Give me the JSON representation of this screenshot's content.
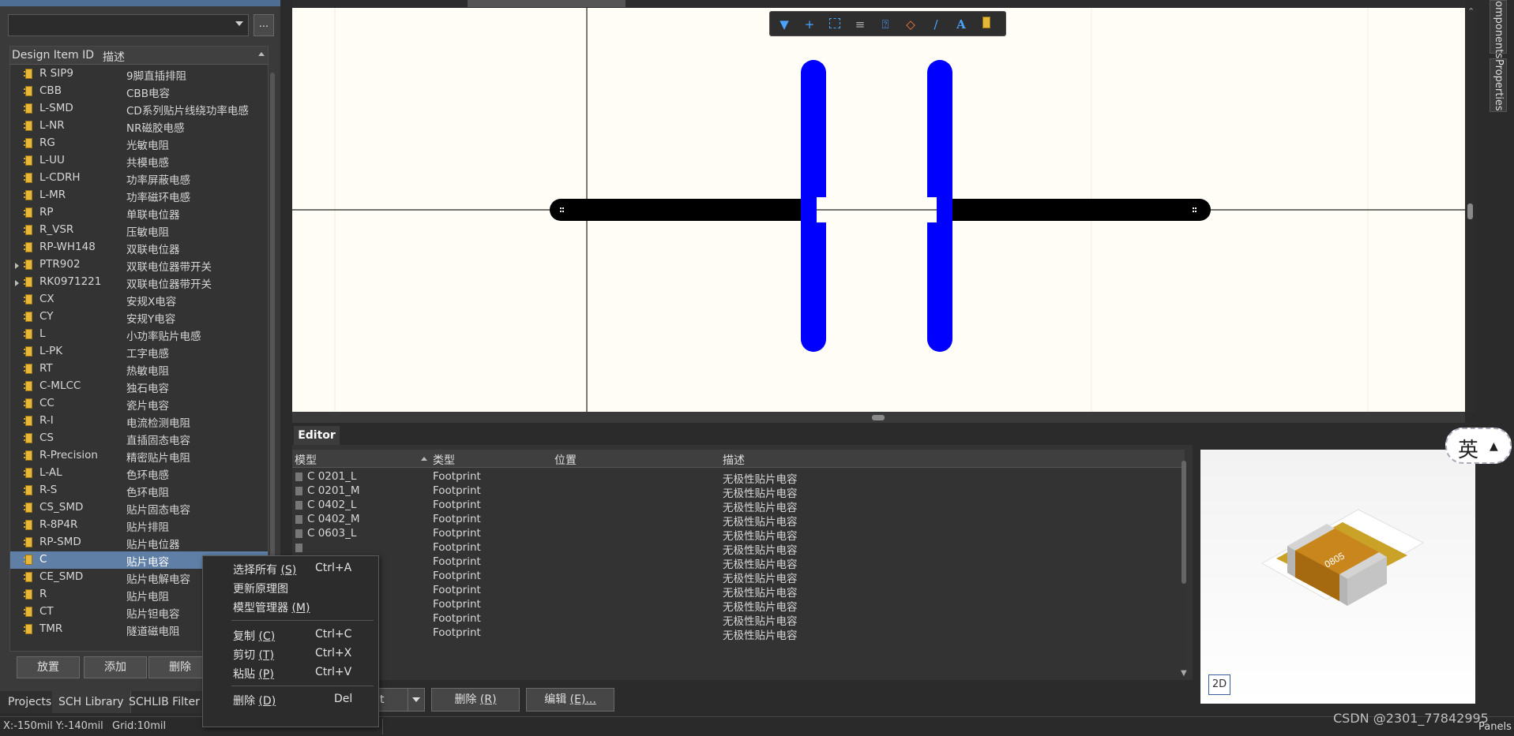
{
  "library": {
    "search_value": "",
    "more_label": "...",
    "columns": [
      "Design Item ID",
      "描述"
    ],
    "rows": [
      {
        "id": "R SIP9",
        "desc": "9脚直插排阻",
        "expandable": false
      },
      {
        "id": "CBB",
        "desc": "CBB电容",
        "expandable": false
      },
      {
        "id": "L-SMD",
        "desc": "CD系列贴片线绕功率电感",
        "expandable": false
      },
      {
        "id": "L-NR",
        "desc": "NR磁胶电感",
        "expandable": false
      },
      {
        "id": "RG",
        "desc": "光敏电阻",
        "expandable": false
      },
      {
        "id": "L-UU",
        "desc": "共模电感",
        "expandable": false
      },
      {
        "id": "L-CDRH",
        "desc": "功率屏蔽电感",
        "expandable": false
      },
      {
        "id": "L-MR",
        "desc": "功率磁环电感",
        "expandable": false
      },
      {
        "id": "RP",
        "desc": "单联电位器",
        "expandable": false
      },
      {
        "id": "R_VSR",
        "desc": "压敏电阻",
        "expandable": false
      },
      {
        "id": "RP-WH148",
        "desc": "双联电位器",
        "expandable": false
      },
      {
        "id": "PTR902",
        "desc": "双联电位器带开关",
        "expandable": true
      },
      {
        "id": "RK0971221",
        "desc": "双联电位器带开关",
        "expandable": true
      },
      {
        "id": "CX",
        "desc": "安规X电容",
        "expandable": false
      },
      {
        "id": "CY",
        "desc": "安规Y电容",
        "expandable": false
      },
      {
        "id": "L",
        "desc": "小功率贴片电感",
        "expandable": false
      },
      {
        "id": "L-PK",
        "desc": "工字电感",
        "expandable": false
      },
      {
        "id": "RT",
        "desc": "热敏电阻",
        "expandable": false
      },
      {
        "id": "C-MLCC",
        "desc": "独石电容",
        "expandable": false
      },
      {
        "id": "CC",
        "desc": "瓷片电容",
        "expandable": false
      },
      {
        "id": "R-I",
        "desc": "电流检测电阻",
        "expandable": false
      },
      {
        "id": "CS",
        "desc": "直插固态电容",
        "expandable": false
      },
      {
        "id": "R-Precision",
        "desc": "精密贴片电阻",
        "expandable": false
      },
      {
        "id": "L-AL",
        "desc": "色环电感",
        "expandable": false
      },
      {
        "id": "R-S",
        "desc": "色环电阻",
        "expandable": false
      },
      {
        "id": "CS_SMD",
        "desc": "贴片固态电容",
        "expandable": false
      },
      {
        "id": "R-8P4R",
        "desc": "贴片排阻",
        "expandable": false
      },
      {
        "id": "RP-SMD",
        "desc": "贴片电位器",
        "expandable": false
      },
      {
        "id": "C",
        "desc": "贴片电容",
        "expandable": false,
        "selected": true
      },
      {
        "id": "CE_SMD",
        "desc": "贴片电解电容",
        "expandable": false
      },
      {
        "id": "R",
        "desc": "贴片电阻",
        "expandable": false
      },
      {
        "id": "CT",
        "desc": "贴片钽电容",
        "expandable": false
      },
      {
        "id": "TMR",
        "desc": "隧道磁电阻",
        "expandable": false
      }
    ],
    "buttons": {
      "place": "放置",
      "add": "添加",
      "delete": "删除"
    }
  },
  "left_tabs": [
    "Projects",
    "SCH Library",
    "SCHLIB Filter"
  ],
  "status": {
    "coords": "X:-150mil Y:-140mil",
    "grid": "Grid:10mil"
  },
  "context_menu": {
    "items": [
      {
        "label": "选择所有 ",
        "key": "(S)",
        "shortcut": "Ctrl+A"
      },
      {
        "label": "更新原理图",
        "key": "",
        "shortcut": ""
      },
      {
        "label": "模型管理器 ",
        "key": "(M)",
        "shortcut": ""
      },
      {
        "label": "复制 ",
        "key": "(C)",
        "shortcut": "Ctrl+C"
      },
      {
        "label": "剪切 ",
        "key": "(T)",
        "shortcut": "Ctrl+X"
      },
      {
        "label": "粘贴 ",
        "key": "(P)",
        "shortcut": "Ctrl+V"
      },
      {
        "label": "删除 ",
        "key": "(D)",
        "shortcut": "Del"
      }
    ]
  },
  "right_tabs": {
    "components": "omponents",
    "properties": "Properties",
    "panels": "Panels"
  },
  "editor": {
    "tab": "Editor",
    "columns": [
      "模型",
      "类型",
      "位置",
      "描述"
    ],
    "rows": [
      {
        "name": "C 0201_L",
        "type": "Footprint",
        "desc": "无极性贴片电容"
      },
      {
        "name": "C 0201_M",
        "type": "Footprint",
        "desc": "无极性贴片电容"
      },
      {
        "name": "C 0402_L",
        "type": "Footprint",
        "desc": "无极性贴片电容"
      },
      {
        "name": "C 0402_M",
        "type": "Footprint",
        "desc": "无极性贴片电容"
      },
      {
        "name": "C 0603_L",
        "type": "Footprint",
        "desc": "无极性贴片电容"
      },
      {
        "name": "",
        "type": "Footprint",
        "desc": "无极性贴片电容"
      },
      {
        "name": "",
        "type": "Footprint",
        "desc": "无极性贴片电容"
      },
      {
        "name": "",
        "type": "Footprint",
        "desc": "无极性贴片电容"
      },
      {
        "name": "",
        "type": "Footprint",
        "desc": "无极性贴片电容"
      },
      {
        "name": "",
        "type": "Footprint",
        "desc": "无极性贴片电容"
      },
      {
        "name": "",
        "type": "Footprint",
        "desc": "无极性贴片电容"
      },
      {
        "name": "",
        "type": "Footprint",
        "desc": "无极性贴片电容"
      }
    ],
    "add_partial": "t",
    "delete_label": "删除 ",
    "delete_key": "(R)",
    "edit_label": "编辑 ",
    "edit_key": "(E)..."
  },
  "preview": {
    "chip_label": "0805",
    "btn_2d": "2D"
  },
  "ime": {
    "label": "英"
  },
  "watermark": "CSDN @2301_77842995"
}
